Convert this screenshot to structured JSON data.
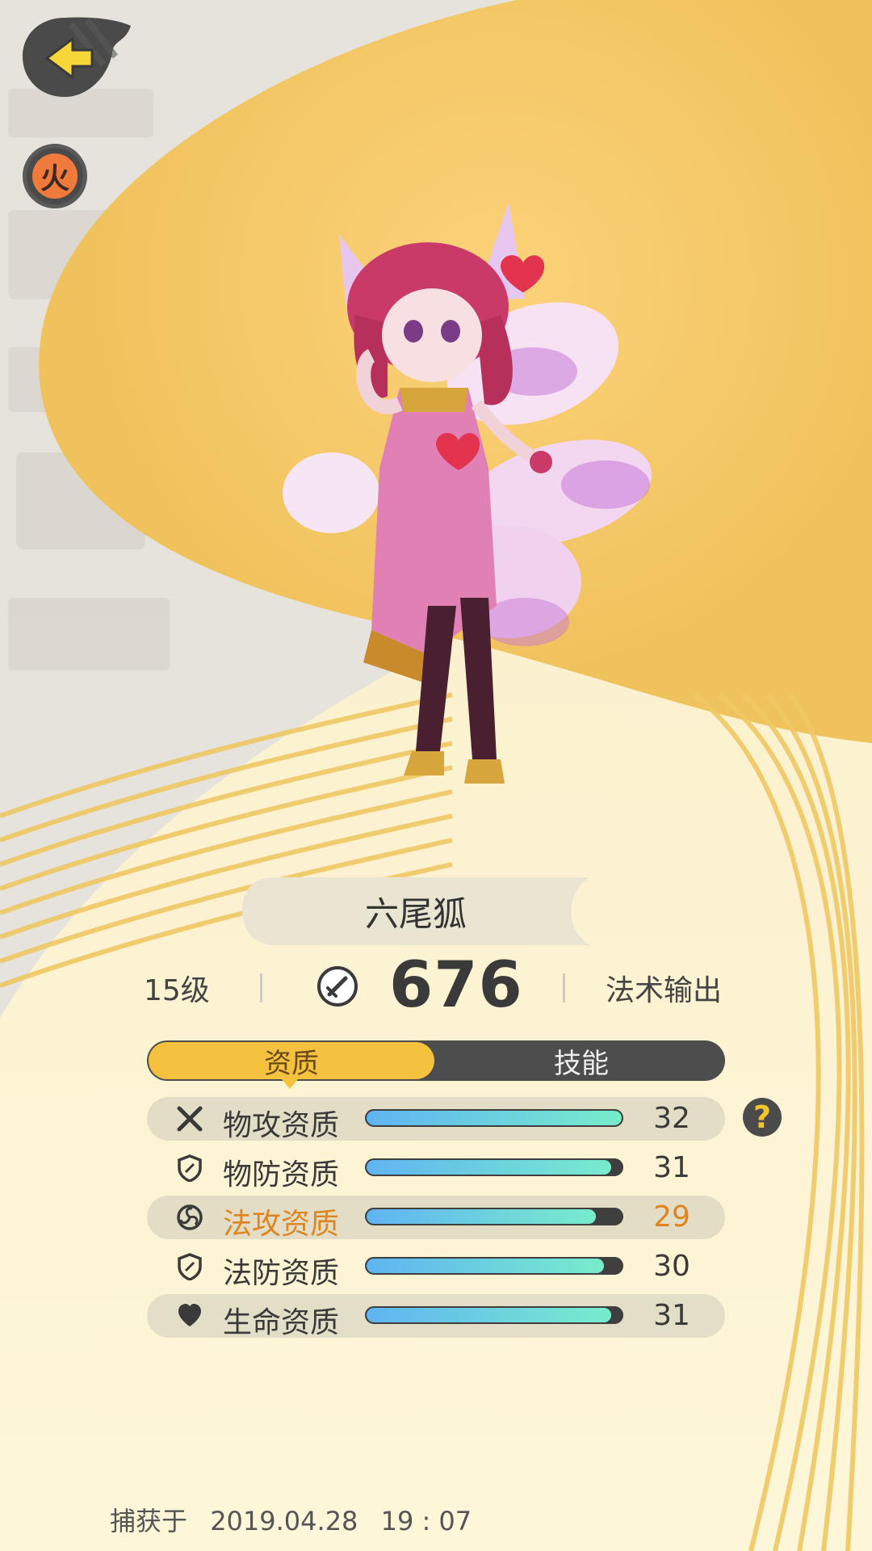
{
  "header": {
    "back_icon": "back-arrow-icon",
    "element_badge_label": "火",
    "element_color": "#f07a3c"
  },
  "pet": {
    "name": "六尾狐",
    "level": "15级",
    "power": "676",
    "role": "法术输出",
    "power_icon": "sword-shield-icon"
  },
  "tabs": {
    "active_label": "资质",
    "inactive_label": "技能"
  },
  "attributes": [
    {
      "icon": "crossed-swords-icon",
      "label": "物攻资质",
      "value": "32",
      "fill": 1.0,
      "highlight": false
    },
    {
      "icon": "shield-icon",
      "label": "物防资质",
      "value": "31",
      "fill": 0.96,
      "highlight": false
    },
    {
      "icon": "magic-swirl-icon",
      "label": "法攻资质",
      "value": "29",
      "fill": 0.9,
      "highlight": true
    },
    {
      "icon": "shield-icon",
      "label": "法防资质",
      "value": "30",
      "fill": 0.93,
      "highlight": false
    },
    {
      "icon": "heart-icon",
      "label": "生命资质",
      "value": "31",
      "fill": 0.96,
      "highlight": false
    }
  ],
  "help_label": "?",
  "capture": {
    "prefix": "捕获于",
    "date": "2019.04.28",
    "time": "19 : 07"
  },
  "colors": {
    "accent_gold": "#f5c23f",
    "highlight_orange": "#e0841f",
    "bar_start": "#5fb4f2",
    "bar_end": "#78eccc"
  }
}
